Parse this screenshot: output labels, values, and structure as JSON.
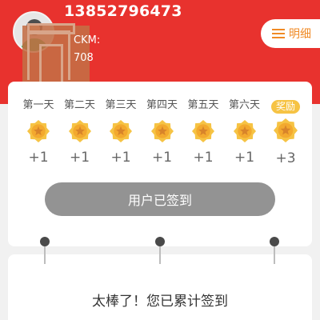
{
  "user": {
    "phone": "13852796473"
  },
  "badge": {
    "line1": "CKM:",
    "line2": "708"
  },
  "header": {
    "detail_label": "明细"
  },
  "checkin": {
    "days": [
      {
        "label": "第一天",
        "points": "+1",
        "reward": false
      },
      {
        "label": "第二天",
        "points": "+1",
        "reward": false
      },
      {
        "label": "第三天",
        "points": "+1",
        "reward": false
      },
      {
        "label": "第四天",
        "points": "+1",
        "reward": false
      },
      {
        "label": "第五天",
        "points": "+1",
        "reward": false
      },
      {
        "label": "第六天",
        "points": "+1",
        "reward": false
      },
      {
        "label": "奖励",
        "points": "+3",
        "reward": true
      }
    ],
    "button_label": "用户已签到"
  },
  "summary": {
    "text": "太棒了！您已累计签到"
  },
  "colors": {
    "brand_red": "#e8322e",
    "accent_orange": "#f08a25",
    "medal_gold": "#f6c344",
    "disabled_gray": "#939393"
  }
}
